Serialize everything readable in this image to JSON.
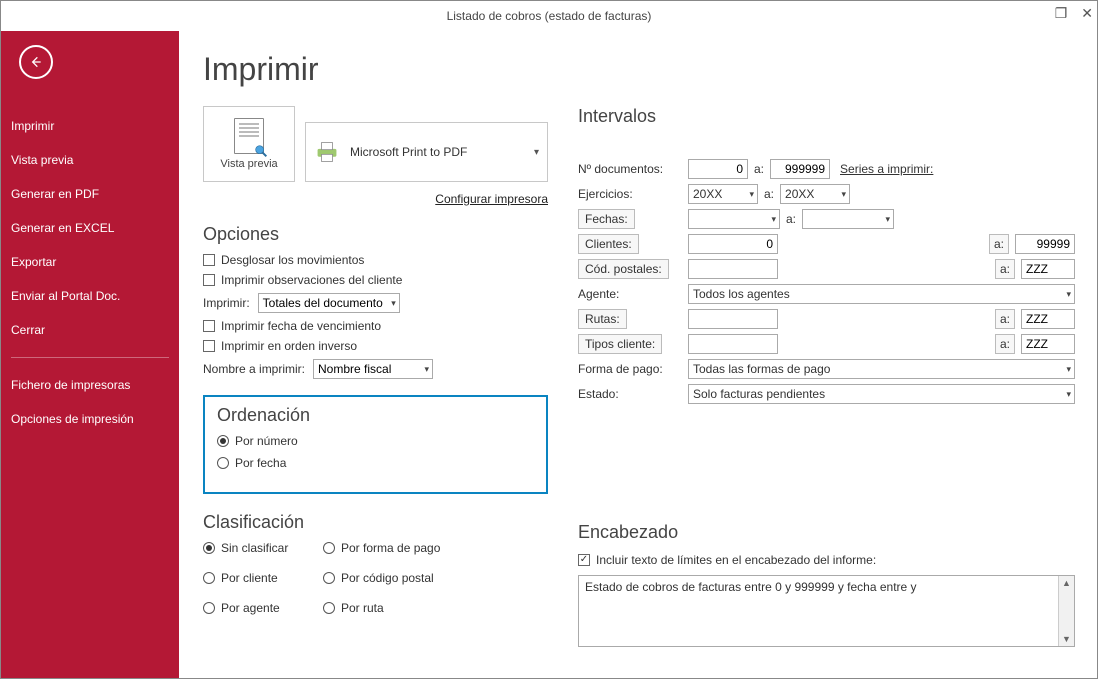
{
  "window": {
    "title": "Listado de cobros (estado de facturas)"
  },
  "sidebar": {
    "items": [
      "Imprimir",
      "Vista previa",
      "Generar en PDF",
      "Generar en EXCEL",
      "Exportar",
      "Enviar al Portal Doc.",
      "Cerrar"
    ],
    "items2": [
      "Fichero de impresoras",
      "Opciones de impresión"
    ]
  },
  "page": {
    "title": "Imprimir"
  },
  "preview": {
    "label": "Vista previa"
  },
  "printer": {
    "name": "Microsoft Print to PDF",
    "configure": "Configurar impresora"
  },
  "opciones": {
    "title": "Opciones",
    "desglosar": "Desglosar los movimientos",
    "obs": "Imprimir observaciones del cliente",
    "imprimir_lbl": "Imprimir:",
    "imprimir_val": "Totales del documento",
    "fecha_venc": "Imprimir fecha de vencimiento",
    "orden_inv": "Imprimir en orden inverso",
    "nombre_lbl": "Nombre a imprimir:",
    "nombre_val": "Nombre fiscal"
  },
  "ordenacion": {
    "title": "Ordenación",
    "por_numero": "Por número",
    "por_fecha": "Por fecha"
  },
  "clasificacion": {
    "title": "Clasificación",
    "sin": "Sin clasificar",
    "forma": "Por forma de pago",
    "cliente": "Por cliente",
    "cp": "Por código postal",
    "agente": "Por agente",
    "ruta": "Por ruta"
  },
  "intervalos": {
    "title": "Intervalos",
    "ndocs_lbl": "Nº documentos:",
    "ndocs_from": "0",
    "ndocs_to": "999999",
    "a": "a:",
    "series": "Series a imprimir:",
    "ejer_lbl": "Ejercicios:",
    "ejer_from": "20XX",
    "ejer_to": "20XX",
    "fechas_lbl": "Fechas:",
    "clientes_lbl": "Clientes:",
    "clientes_from": "0",
    "clientes_to": "99999",
    "cp_lbl": "Cód. postales:",
    "cp_to": "ZZZ",
    "agente_lbl": "Agente:",
    "agente_val": "Todos los agentes",
    "rutas_lbl": "Rutas:",
    "rutas_to": "ZZZ",
    "tipos_lbl": "Tipos cliente:",
    "tipos_to": "ZZZ",
    "forma_lbl": "Forma de pago:",
    "forma_val": "Todas las formas de pago",
    "estado_lbl": "Estado:",
    "estado_val": "Solo facturas pendientes"
  },
  "encabezado": {
    "title": "Encabezado",
    "chk": "Incluir texto de límites en el encabezado del informe:",
    "text": "Estado de cobros de facturas entre 0 y 999999 y fecha entre  y"
  }
}
